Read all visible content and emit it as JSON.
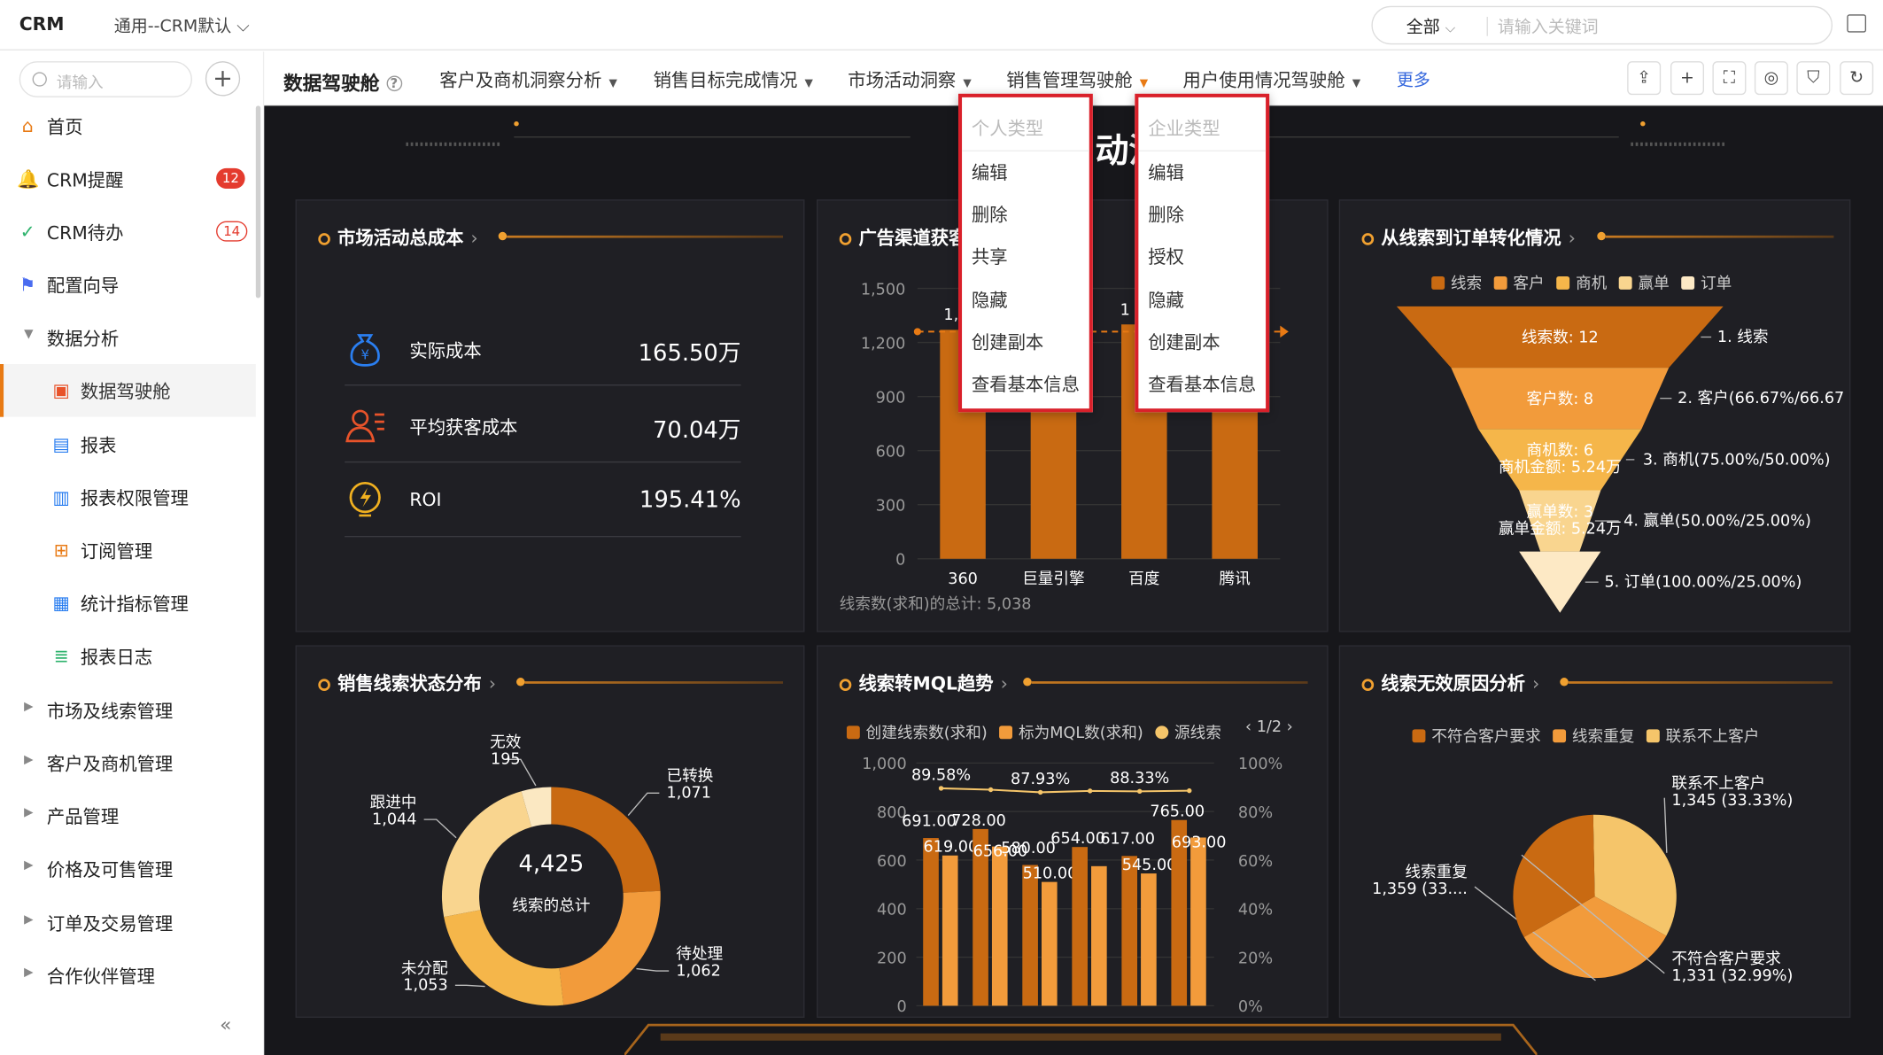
{
  "top": {
    "logo": "CRM",
    "workspace": "通用--CRM默认",
    "search_scope": "全部",
    "search_placeholder": "请输入关键词"
  },
  "sidebar": {
    "search_placeholder": "请输入",
    "collapse": "«",
    "items": [
      {
        "label": "首页",
        "icon": "home-icon"
      },
      {
        "label": "CRM提醒",
        "badge": "12",
        "icon": "bell-icon"
      },
      {
        "label": "CRM待办",
        "badge": "14",
        "icon": "check-circle-icon"
      },
      {
        "label": "配置向导",
        "icon": "flag-icon"
      },
      {
        "label": "数据分析",
        "icon": "caret-down-icon"
      },
      {
        "label": "数据驾驶舱",
        "icon": "dashboard-icon"
      },
      {
        "label": "报表",
        "icon": "report-icon"
      },
      {
        "label": "报表权限管理",
        "icon": "report-permission-icon"
      },
      {
        "label": "订阅管理",
        "icon": "subscribe-icon"
      },
      {
        "label": "统计指标管理",
        "icon": "metric-icon"
      },
      {
        "label": "报表日志",
        "icon": "log-icon"
      },
      {
        "label": "市场及线索管理",
        "icon": "caret-right-icon"
      },
      {
        "label": "客户及商机管理",
        "icon": "caret-right-icon"
      },
      {
        "label": "产品管理",
        "icon": "caret-right-icon"
      },
      {
        "label": "价格及可售管理",
        "icon": "caret-right-icon"
      },
      {
        "label": "订单及交易管理",
        "icon": "caret-right-icon"
      },
      {
        "label": "合作伙伴管理",
        "icon": "caret-right-icon"
      }
    ]
  },
  "tabs": {
    "title": "数据驾驶舱",
    "items": [
      "客户及商机洞察分析",
      "销售目标完成情况",
      "市场活动洞察",
      "销售管理驾驶舱",
      "用户使用情况驾驶舱"
    ],
    "more": "更多"
  },
  "menus": [
    {
      "header": "个人类型",
      "items": [
        "编辑",
        "删除",
        "共享",
        "隐藏",
        "创建副本",
        "查看基本信息"
      ]
    },
    {
      "header": "企业类型",
      "items": [
        "编辑",
        "删除",
        "授权",
        "隐藏",
        "创建副本",
        "查看基本信息"
      ]
    }
  ],
  "dash": {
    "banner_fragment": "动洞",
    "p1": {
      "title": "市场活动总成本",
      "kpis": [
        {
          "label": "实际成本",
          "value": "165.50万"
        },
        {
          "label": "平均获客成本",
          "value": "70.04万"
        },
        {
          "label": "ROI",
          "value": "195.41%"
        }
      ]
    },
    "p2": {
      "title": "广告渠道获客",
      "footer": "线索数(求和)的总计: 5,038",
      "bar_label_fragments": [
        "1,",
        "1"
      ]
    },
    "p3": {
      "title": "从线索到订单转化情况",
      "legend": [
        "线索",
        "客户",
        "商机",
        "赢单",
        "订单"
      ],
      "stages": [
        {
          "inner": "线索数: 12",
          "right": "1. 线索"
        },
        {
          "inner": "客户数: 8",
          "right": "2. 客户(66.67%/66.67"
        },
        {
          "inner": "商机数: 6",
          "inner2": "商机金额: 5.24万",
          "right": "3. 商机(75.00%/50.00%)"
        },
        {
          "inner": "赢单数: 3",
          "inner2": "赢单金额: 5.24万",
          "right": "4. 赢单(50.00%/25.00%)"
        },
        {
          "right": "5. 订单(100.00%/25.00%)"
        }
      ]
    },
    "p4": {
      "title": "销售线索状态分布",
      "total": "4,425",
      "total_label": "线索的总计"
    },
    "p5": {
      "title": "线索转MQL趋势",
      "legend": [
        "创建线索数(求和)",
        "标为MQL数(求和)",
        "源线索"
      ],
      "pager": "1/2"
    },
    "p6": {
      "title": "线索无效原因分析",
      "legend": [
        "不符合客户要求",
        "线索重复",
        "联系不上客户"
      ]
    }
  },
  "chart_data": [
    {
      "type": "bar",
      "title": "广告渠道获客",
      "categories": [
        "360",
        "巨量引擎",
        "百度",
        "腾讯"
      ],
      "values": [
        1270,
        1260,
        1300,
        1208
      ],
      "yticks": [
        0,
        300,
        600,
        900,
        "1,200",
        "1,500"
      ],
      "ylim": [
        0,
        1500
      ]
    },
    {
      "type": "funnel",
      "title": "从线索到订单转化情况",
      "categories": [
        "线索",
        "客户",
        "商机",
        "赢单",
        "订单"
      ],
      "values": [
        12,
        8,
        6,
        3,
        3
      ]
    },
    {
      "type": "pie",
      "title": "销售线索状态分布",
      "labels": [
        "已转换",
        "待处理",
        "未分配",
        "跟进中",
        "无效"
      ],
      "values": [
        1071,
        1062,
        1053,
        1044,
        195
      ],
      "display": [
        "1,071",
        "1,062",
        "1,053",
        "1,044",
        "195"
      ],
      "colors": [
        "#c96a12",
        "#f29b3b",
        "#f5b64a",
        "#f9d58f",
        "#fbe8c2"
      ]
    },
    {
      "type": "bar",
      "title": "线索转MQL趋势",
      "series": [
        {
          "name": "创建线索数(求和)",
          "values": [
            691,
            728,
            580,
            654,
            617,
            765
          ]
        },
        {
          "name": "标为MQL数(求和)",
          "values": [
            619,
            656,
            510,
            575,
            545,
            693
          ]
        },
        {
          "name": "源线索",
          "values": [
            89.58,
            89.0,
            87.93,
            88.5,
            88.33,
            88.6
          ]
        }
      ],
      "labels_c": [
        "691.00",
        "728.00",
        "580.00",
        "654.00",
        "617.00",
        "765.00"
      ],
      "labels_m": [
        "619.00",
        "656.00",
        "510.00",
        "",
        "545.00",
        "693.00"
      ],
      "pct_labels": [
        "89.58%",
        "87.93%",
        "88.33%"
      ],
      "yticks": [
        "0",
        "200",
        "400",
        "600",
        "800",
        "1,000"
      ],
      "y2ticks": [
        "0%",
        "20%",
        "40%",
        "60%",
        "80%",
        "100%"
      ]
    },
    {
      "type": "pie",
      "title": "线索无效原因分析",
      "labels": [
        "联系不上客户",
        "线索重复",
        "不符合客户要求"
      ],
      "values": [
        1345,
        1359,
        1331
      ],
      "display": [
        "1,345 (33.33%)",
        "1,359 (33....",
        "1,331 (32.99%)"
      ],
      "colors": [
        "#f5c56a",
        "#f29b3b",
        "#c96a12"
      ]
    }
  ]
}
